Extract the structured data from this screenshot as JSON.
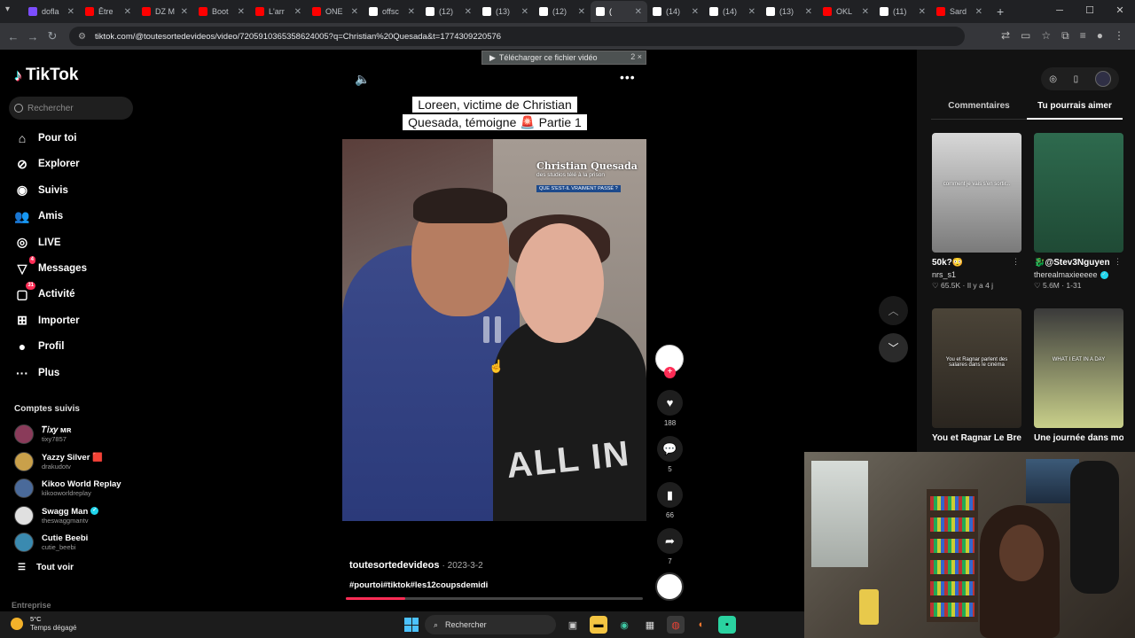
{
  "browser": {
    "tabs": [
      {
        "label": "dofla",
        "color": "#7c4dff"
      },
      {
        "label": "Être",
        "color": "#ff0000"
      },
      {
        "label": "DZ M",
        "color": "#ff0000"
      },
      {
        "label": "Boot",
        "color": "#ff0000"
      },
      {
        "label": "L'arr",
        "color": "#ff0000"
      },
      {
        "label": "ONE",
        "color": "#ff0000"
      },
      {
        "label": "offsc",
        "color": "#ffffff"
      },
      {
        "label": "(12)",
        "color": "#ffffff"
      },
      {
        "label": "(13)",
        "color": "#ffffff"
      },
      {
        "label": "(12)",
        "color": "#ffffff"
      },
      {
        "label": "(",
        "color": "#ffffff"
      },
      {
        "label": "(14)",
        "color": "#ffffff"
      },
      {
        "label": "(14)",
        "color": "#ffffff"
      },
      {
        "label": "(13)",
        "color": "#ffffff"
      },
      {
        "label": "OKL",
        "color": "#ff0000"
      },
      {
        "label": "(11)",
        "color": "#ffffff"
      },
      {
        "label": "Sard",
        "color": "#ff0000"
      }
    ],
    "url": "tiktok.com/@toutesortedevideos/video/7205910365358624005?q=Christian%20Quesada&t=1774309220576",
    "download_bar": "Télécharger ce fichier vidéo",
    "download_extra": "2 ×"
  },
  "sidebar": {
    "logo": "TikTok",
    "search_placeholder": "Rechercher",
    "nav": [
      {
        "label": "Pour toi",
        "icon": "home-icon"
      },
      {
        "label": "Explorer",
        "icon": "compass-icon"
      },
      {
        "label": "Suivis",
        "icon": "following-icon"
      },
      {
        "label": "Amis",
        "icon": "friends-icon"
      },
      {
        "label": "LIVE",
        "icon": "live-icon"
      },
      {
        "label": "Messages",
        "icon": "messages-icon",
        "badge": "4"
      },
      {
        "label": "Activité",
        "icon": "activity-icon",
        "badge": "31"
      },
      {
        "label": "Importer",
        "icon": "upload-icon"
      },
      {
        "label": "Profil",
        "icon": "profile-icon"
      },
      {
        "label": "Plus",
        "icon": "more-icon"
      }
    ],
    "following_title": "Comptes suivis",
    "following": [
      {
        "name": "𝑇𝑖𝑥𝑦 ᴍʀ",
        "handle": "tixy7857",
        "color": "#8a3b5a"
      },
      {
        "name": "Yazzy Silver 🟥",
        "handle": "drakudotv",
        "color": "#c9a04a"
      },
      {
        "name": "Kikoo World Replay",
        "handle": "kikooworldreplay",
        "color": "#4a6a9a"
      },
      {
        "name": "Swagg Man",
        "handle": "theswaggmantv",
        "color": "#e0e0e0",
        "verified": true
      },
      {
        "name": "Cutie Beebi",
        "handle": "cutie_beebi",
        "color": "#3a8ab0"
      }
    ],
    "see_all": "Tout voir",
    "footer": "Entreprise"
  },
  "video": {
    "caption": "Loreen, victime de Christian Quesada, témoigne 🚨 Partie 1",
    "brand_title": "Christian Quesada",
    "brand_sub": "des studios télé à la prison",
    "brand_tag": "QUE S'EST-IL VRAIMENT PASSÉ ?",
    "shirt_text": "ALL IN",
    "author": "toutesortedevideos",
    "date": "2023-3-2",
    "hashtags": "#pourtoi#tiktok#les12coupsdemidi",
    "progress": 0.2,
    "likes": "188",
    "comments": "5",
    "saves": "66",
    "shares": "7"
  },
  "right_panel": {
    "tabs": [
      "Commentaires",
      "Tu pourrais aimer"
    ],
    "active_tab": 1,
    "cards": [
      {
        "title": "50k?😳",
        "user": "nrs_s1",
        "stats": "65.5K · Il y a 4 j",
        "overlay": "comment je vais s'en sortir...",
        "bg": "linear-gradient(180deg,#d8d8d8,#7a7a7a)"
      },
      {
        "title": "🐉@Stev3Nguyen",
        "user": "therealmaxieeeee",
        "stats": "5.6M · 1-31",
        "verified": true,
        "overlay": "",
        "bg": "linear-gradient(180deg,#2e6a4e,#1f4a35)"
      },
      {
        "title": "You et Ragnar Le Breton parlent d",
        "user": "",
        "stats": "",
        "overlay": "You et Ragnar parlent des salaires dans le cinéma",
        "bg": "linear-gradient(180deg,#4b4438,#2a251f)"
      },
      {
        "title": "Une journée dans mon assiette !",
        "user": "",
        "stats": "",
        "overlay": "WHAT I EAT IN A DAY",
        "bg": "linear-gradient(180deg,#3a3a3a,#c9d08a)"
      }
    ]
  },
  "taskbar": {
    "temp": "5°C",
    "weather": "Temps dégagé",
    "search": "Rechercher"
  }
}
